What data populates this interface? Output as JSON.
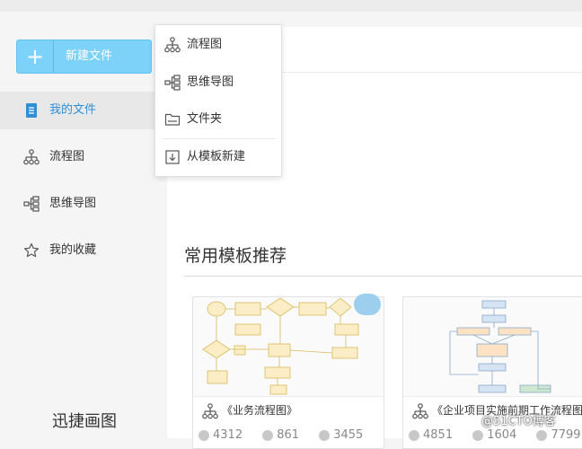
{
  "toolbar": {
    "new_file_label": "新建文件",
    "new_icon": "plus-icon"
  },
  "sidebar": {
    "items": [
      {
        "label": "我的文件",
        "icon": "document-icon",
        "active": true
      },
      {
        "label": "流程图",
        "icon": "flowchart-icon",
        "active": false
      },
      {
        "label": "思维导图",
        "icon": "mindmap-icon",
        "active": false
      },
      {
        "label": "我的收藏",
        "icon": "star-icon",
        "active": false
      }
    ],
    "app_name": "迅捷画图"
  },
  "dropdown": {
    "items": [
      {
        "label": "流程图",
        "icon": "flowchart-icon"
      },
      {
        "label": "思维导图",
        "icon": "mindmap-icon"
      },
      {
        "label": "文件夹",
        "icon": "folder-icon"
      },
      {
        "label": "从模板新建",
        "icon": "template-icon"
      }
    ]
  },
  "templates": {
    "title": "常用模板推荐",
    "cards": [
      {
        "title": "《业务流程图》",
        "views": "4312",
        "stars": "861",
        "edits": "3455"
      },
      {
        "title": "《企业项目实施前期工作流程图》",
        "views": "4851",
        "stars": "1604",
        "edits": "7799"
      }
    ]
  },
  "watermark": "@51CTO博客",
  "colors": {
    "accent": "#7cd2f8",
    "active_text": "#2f8fd5",
    "flow_yellow": "#fbeec6"
  }
}
